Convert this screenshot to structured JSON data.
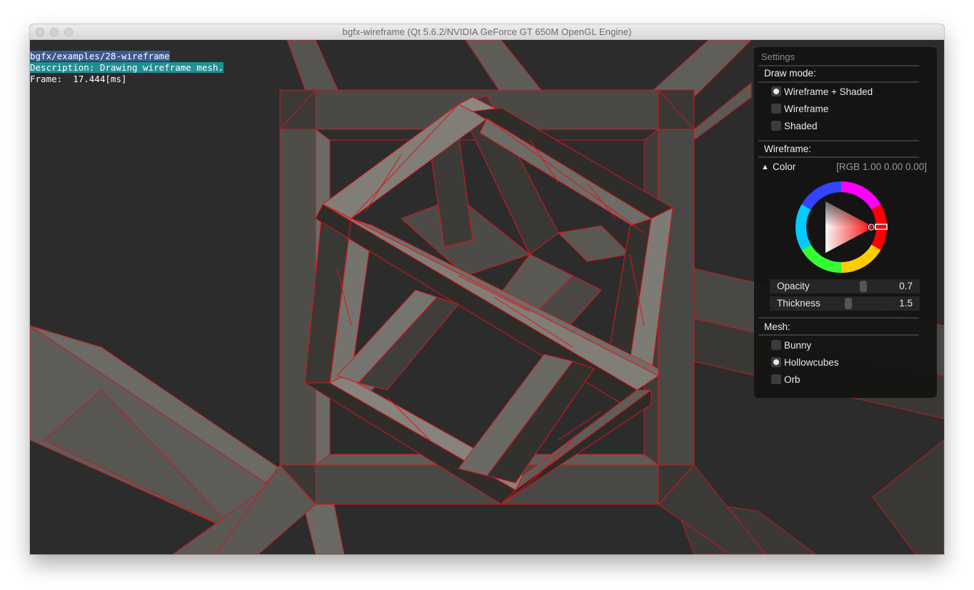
{
  "window": {
    "title": "bgfx-wireframe (Qt 5.6.2/NVIDIA GeForce GT 650M OpenGL Engine)"
  },
  "debug_overlay": {
    "line1": "bgfx/examples/28-wireframe",
    "line2": "Description: Drawing wireframe mesh.",
    "line3": "Frame:  17.444[ms]"
  },
  "settings": {
    "title": "Settings",
    "draw_mode": {
      "label": "Draw mode:",
      "options": [
        {
          "label": "Wireframe + Shaded",
          "selected": true
        },
        {
          "label": "Wireframe",
          "selected": false
        },
        {
          "label": "Shaded",
          "selected": false
        }
      ]
    },
    "wireframe": {
      "label": "Wireframe:",
      "color_label": "Color",
      "color_arrow": "▲",
      "color_value": "[RGB 1.00 0.00 0.00]",
      "color_hex": "#ff0000",
      "opacity_label": "Opacity",
      "opacity_value": "0.7",
      "thickness_label": "Thickness",
      "thickness_value": "1.5"
    },
    "mesh": {
      "label": "Mesh:",
      "options": [
        {
          "label": "Bunny",
          "selected": false
        },
        {
          "label": "Hollowcubes",
          "selected": true
        },
        {
          "label": "Orb",
          "selected": false
        }
      ]
    }
  },
  "colors": {
    "wire": "#e0131a",
    "background": "#2c2c2c",
    "face_light": "#6e6c66",
    "face_dark": "#2d2b28"
  }
}
